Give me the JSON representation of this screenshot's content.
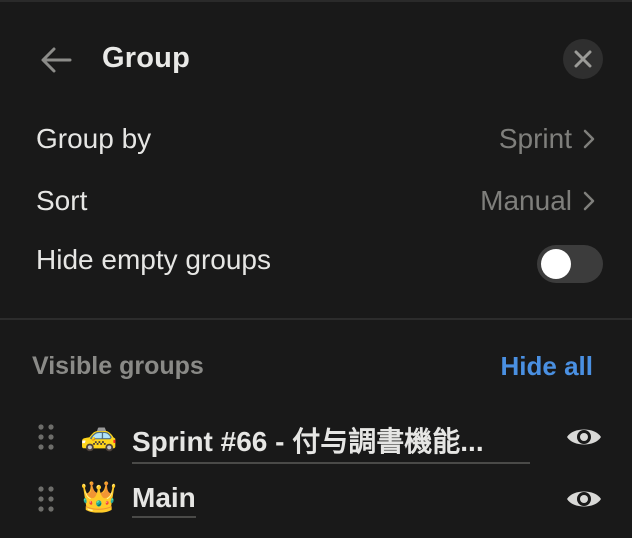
{
  "header": {
    "title": "Group",
    "back_icon": "arrow-left-icon",
    "close_icon": "close-icon"
  },
  "settings": {
    "group_by": {
      "label": "Group by",
      "value": "Sprint"
    },
    "sort": {
      "label": "Sort",
      "value": "Manual"
    },
    "hide_empty": {
      "label": "Hide empty groups",
      "enabled": false
    }
  },
  "visible_groups": {
    "title": "Visible groups",
    "hide_all_label": "Hide all",
    "items": [
      {
        "emoji": "🚕",
        "name": "Sprint #66 - 付与調書機能...",
        "visible": true
      },
      {
        "emoji": "👑",
        "name": "Main",
        "visible": true
      }
    ]
  },
  "colors": {
    "background": "#191919",
    "accent": "#4a90e2",
    "muted_text": "#7f7f7c"
  }
}
